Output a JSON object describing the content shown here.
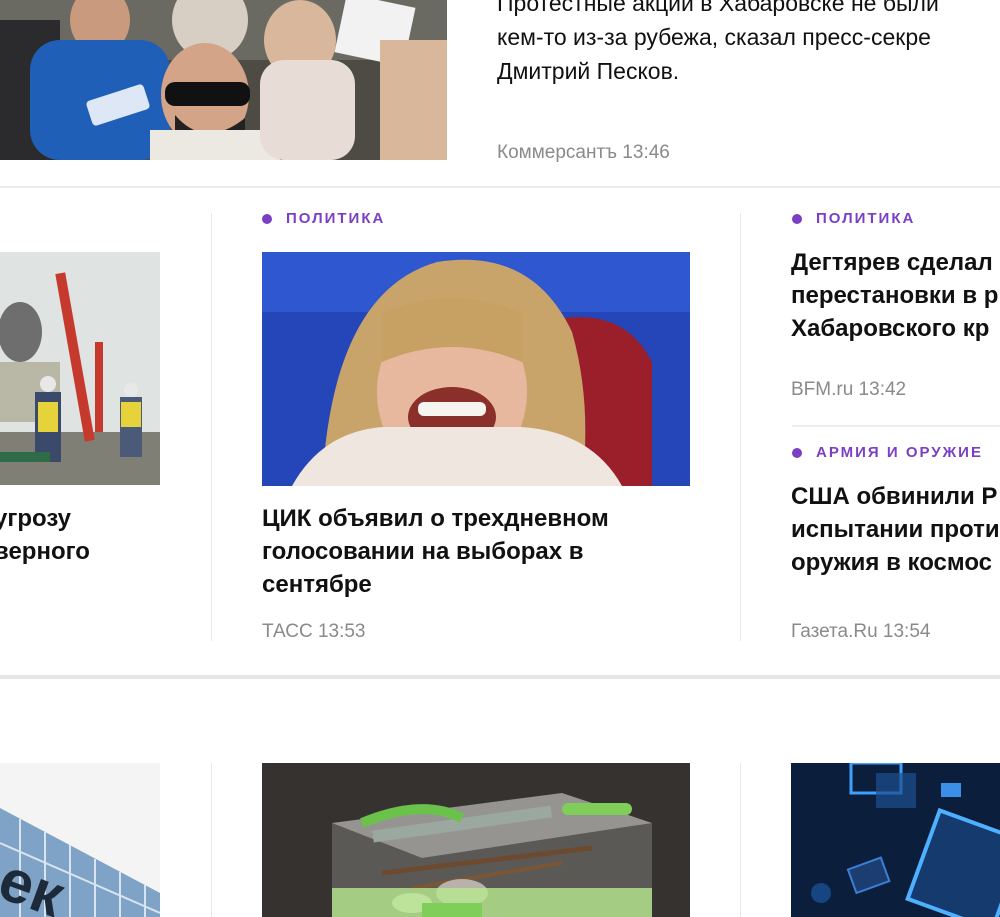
{
  "top_story": {
    "lines": [
      "Протестные акции в Хабаровске не были",
      "кем-то из-за рубежа, сказал пресс-секре",
      "Дмитрий Песков."
    ],
    "source": "Коммерсантъ 13:46"
  },
  "row1": {
    "left": {
      "lines": [
        "угрозу",
        "верного"
      ]
    },
    "center": {
      "rubric": "ПОЛИТИКА",
      "lines": [
        "ЦИК объявил о трехдневном",
        "голосовании на выборах в",
        "сентябре"
      ],
      "source": "ТАСС 13:53"
    },
    "right_top": {
      "rubric": "ПОЛИТИКА",
      "lines": [
        "Дегтярев сделал",
        "перестановки в р",
        "Хабаровского кр"
      ],
      "source": "BFM.ru 13:42"
    },
    "right_bottom": {
      "rubric": "АРМИЯ И ОРУЖИЕ",
      "lines": [
        "США обвинили Р",
        "испытании проти",
        "оружия в космос"
      ],
      "source": "Газета.Ru 13:54"
    }
  },
  "row2": {
    "left_sign": "ек"
  },
  "colors": {
    "accent": "#7b3fc4",
    "source": "#8a8a8a",
    "separator": "#e6e6e6"
  }
}
